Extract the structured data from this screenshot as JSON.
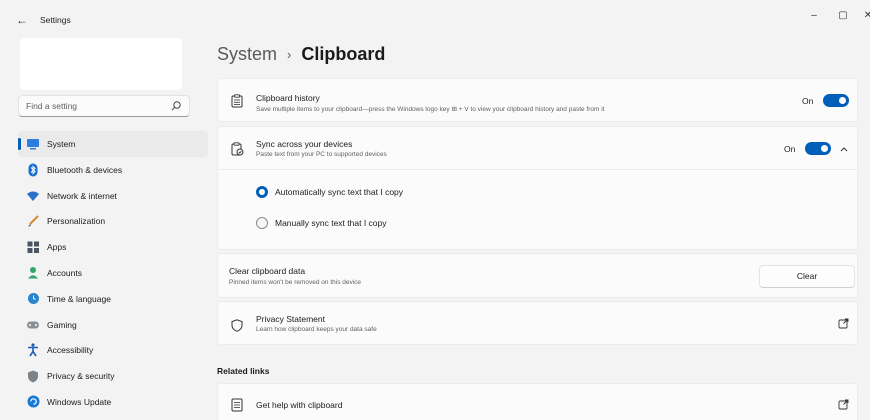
{
  "window": {
    "title": "Settings",
    "back_glyph": "←",
    "minimize_glyph": "–",
    "restore_glyph": "▢",
    "close_glyph": "✕"
  },
  "search": {
    "placeholder": "Find a setting",
    "icon": "search-icon"
  },
  "sidebar": {
    "items": [
      {
        "label": "System",
        "icon": "system-icon",
        "active": true
      },
      {
        "label": "Bluetooth & devices",
        "icon": "bluetooth-icon"
      },
      {
        "label": "Network & internet",
        "icon": "wifi-icon"
      },
      {
        "label": "Personalization",
        "icon": "brush-icon"
      },
      {
        "label": "Apps",
        "icon": "apps-icon"
      },
      {
        "label": "Accounts",
        "icon": "person-icon"
      },
      {
        "label": "Time & language",
        "icon": "globe-clock-icon"
      },
      {
        "label": "Gaming",
        "icon": "gamepad-icon"
      },
      {
        "label": "Accessibility",
        "icon": "accessibility-icon"
      },
      {
        "label": "Privacy & security",
        "icon": "shield-icon"
      },
      {
        "label": "Windows Update",
        "icon": "update-icon"
      }
    ]
  },
  "breadcrumb": {
    "parent": "System",
    "separator": "›",
    "current": "Clipboard"
  },
  "settings": {
    "clipboard_history": {
      "title": "Clipboard history",
      "description": "Save multiple items to your clipboard—press the Windows logo key ⊞ + V to view your clipboard history and paste from it",
      "state_label": "On",
      "enabled": true
    },
    "sync": {
      "title": "Sync across your devices",
      "description": "Paste text from your PC to supported devices",
      "state_label": "On",
      "enabled": true,
      "options": [
        {
          "label": "Automatically sync text that I copy",
          "selected": true
        },
        {
          "label": "Manually sync text that I copy",
          "selected": false
        }
      ]
    },
    "clear": {
      "title": "Clear clipboard data",
      "description": "Pinned items won't be removed on this device",
      "button_label": "Clear"
    },
    "privacy": {
      "title": "Privacy Statement",
      "description": "Learn how clipboard keeps your data safe"
    }
  },
  "related_links": {
    "heading": "Related links",
    "items": [
      {
        "label": "Get help with clipboard"
      }
    ]
  },
  "colors": {
    "accent": "#005fb8",
    "background": "#f3f3f3",
    "card": "#fbfbfb"
  }
}
